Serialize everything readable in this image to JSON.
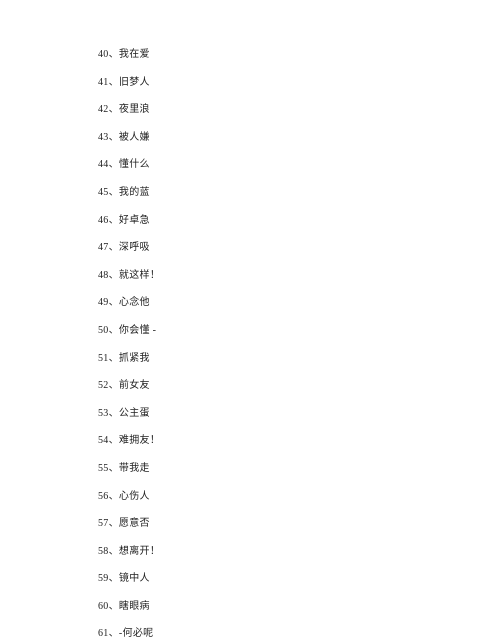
{
  "items": [
    {
      "num": "40",
      "text": "我在爱"
    },
    {
      "num": "41",
      "text": "旧梦人"
    },
    {
      "num": "42",
      "text": "夜里浪"
    },
    {
      "num": "43",
      "text": "被人嫌"
    },
    {
      "num": "44",
      "text": "懂什么"
    },
    {
      "num": "45",
      "text": "我的蓝"
    },
    {
      "num": "46",
      "text": "好卓急"
    },
    {
      "num": "47",
      "text": "深呼吸"
    },
    {
      "num": "48",
      "text": "就这样！"
    },
    {
      "num": "49",
      "text": "心念他"
    },
    {
      "num": "50",
      "text": "你会懂 -"
    },
    {
      "num": "51",
      "text": "抓紧我"
    },
    {
      "num": "52",
      "text": "前女友"
    },
    {
      "num": "53",
      "text": "公主蛋"
    },
    {
      "num": "54",
      "text": "难拥友！"
    },
    {
      "num": "55",
      "text": "带我走"
    },
    {
      "num": "56",
      "text": "心伤人"
    },
    {
      "num": "57",
      "text": "愿意否"
    },
    {
      "num": "58",
      "text": "想离开！"
    },
    {
      "num": "59",
      "text": "镜中人"
    },
    {
      "num": "60",
      "text": "瞎眼病"
    },
    {
      "num": "61",
      "text": "-何必呢"
    }
  ],
  "separator": "、"
}
